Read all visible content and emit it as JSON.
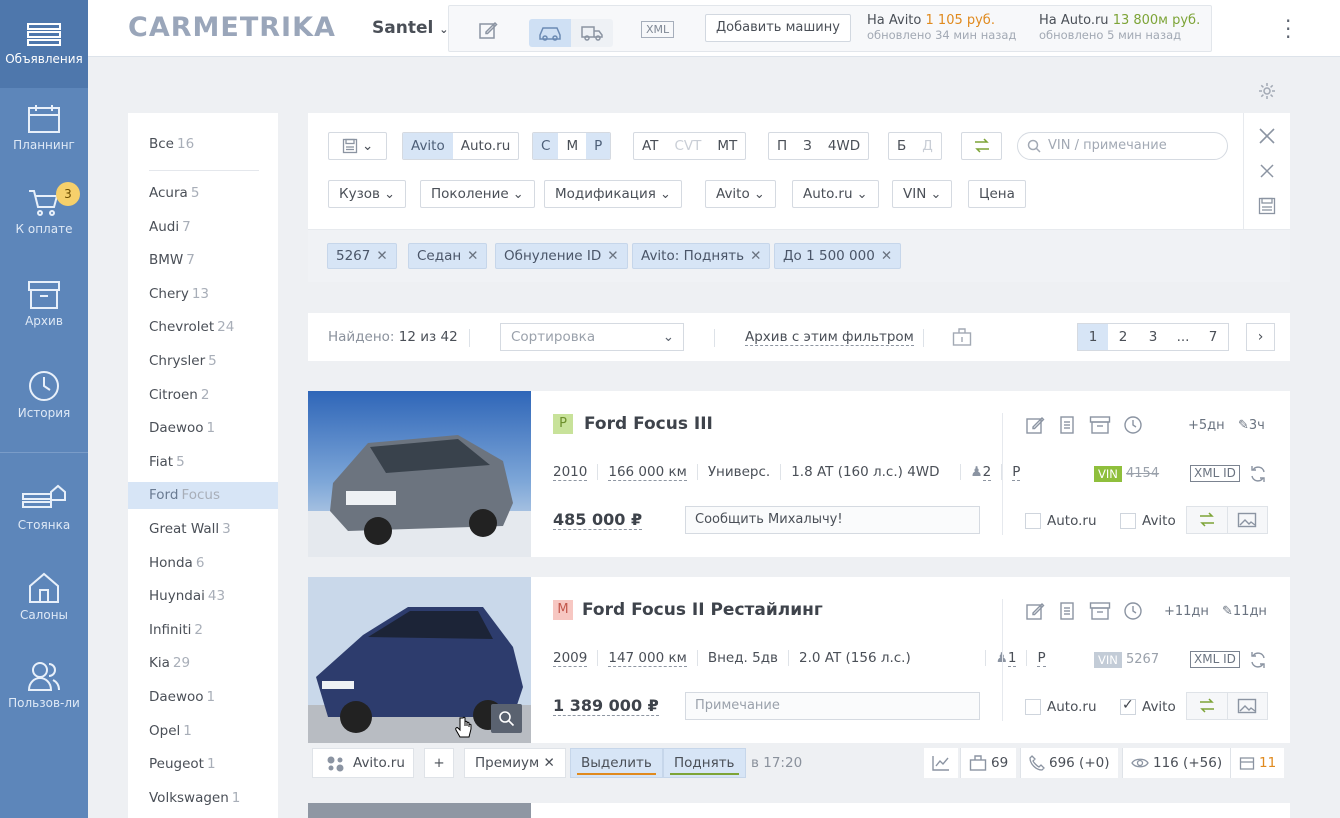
{
  "nav": {
    "items": [
      {
        "label": "Объявления",
        "icon": "listings-icon",
        "active": true
      },
      {
        "label": "Планнинг",
        "icon": "calendar-icon"
      },
      {
        "label": "К оплате",
        "icon": "cart-icon",
        "badge": "3"
      },
      {
        "label": "Архив",
        "icon": "archive-icon"
      },
      {
        "label": "История",
        "icon": "clock-icon"
      },
      {
        "label": "Стоянка",
        "icon": "parking-icon"
      },
      {
        "label": "Салоны",
        "icon": "showroom-icon"
      },
      {
        "label": "Пользов-ли",
        "icon": "users-icon"
      }
    ]
  },
  "header": {
    "logo": "CARMETRIKA",
    "company": "Santel",
    "xml_label": "XML",
    "add_car_label": "Добавить машину",
    "avito_balance": {
      "prefix": "На Avito",
      "amount": "1 105 руб.",
      "updated": "обновлено 34 мин назад"
    },
    "autoru_balance": {
      "prefix": "На Auto.ru",
      "amount": "13 800м руб.",
      "updated": "обновлено 5 мин назад"
    }
  },
  "brands": {
    "all_label": "Все",
    "all_count": "16",
    "items": [
      {
        "name": "Acura",
        "count": "5"
      },
      {
        "name": "Audi",
        "count": "7"
      },
      {
        "name": "BMW",
        "count": "7"
      },
      {
        "name": "Chery",
        "count": "13"
      },
      {
        "name": "Chevrolet",
        "count": "24"
      },
      {
        "name": "Chrysler",
        "count": "5"
      },
      {
        "name": "Citroen",
        "count": "2"
      },
      {
        "name": "Daewoo",
        "count": "1"
      },
      {
        "name": "Fiat",
        "count": "5"
      },
      {
        "name": "Ford",
        "count": "Focus",
        "selected": true
      },
      {
        "name": "Great Wall",
        "count": "3"
      },
      {
        "name": "Honda",
        "count": "6"
      },
      {
        "name": "Huyndai",
        "count": "43"
      },
      {
        "name": "Infiniti",
        "count": "2"
      },
      {
        "name": "Kia",
        "count": "29"
      },
      {
        "name": "Daewoo",
        "count": "1"
      },
      {
        "name": "Opel",
        "count": "1"
      },
      {
        "name": "Peugeot",
        "count": "1"
      },
      {
        "name": "Volkswagen",
        "count": "1"
      }
    ]
  },
  "filters": {
    "sites": [
      "Avito",
      "Auto.ru"
    ],
    "cmp": [
      "С",
      "М",
      "Р"
    ],
    "gearbox": [
      "AT",
      "CVT",
      "MT"
    ],
    "drive": [
      "П",
      "З",
      "4WD"
    ],
    "used": [
      "Б",
      "Д"
    ],
    "search_placeholder": "VIN / примечание",
    "dropdowns": [
      "Кузов",
      "Поколение",
      "Модификация",
      "Avito",
      "Auto.ru",
      "VIN"
    ],
    "price_label": "Цена",
    "tags": [
      "5267",
      "Седан",
      "Обнуление ID",
      "Avito: Поднять",
      "До 1 500 000"
    ]
  },
  "results": {
    "found_label": "Найдено:",
    "found_value": "12 из 42",
    "sort_placeholder": "Сортировка",
    "archive_link": "Архив с этим фильтром",
    "pages": [
      "1",
      "2",
      "3",
      "...",
      "7"
    ],
    "next": "›"
  },
  "cards": [
    {
      "class_letter": "P",
      "class_color": "#c8e29a",
      "class_text_color": "#6d8f2c",
      "title": "Ford Focus III",
      "year": "2010",
      "mileage": "166 000 км",
      "body": "Универс.",
      "engine": "1.8 AT (160 л.с.) 4WD",
      "owners": "2",
      "pts": "Р",
      "price": "485 000 ₽",
      "note": "Сообщить Михалычу!",
      "days_a": "+5дн",
      "days_b": "3ч",
      "vin_label": "VIN",
      "vin_color": "#8fbf3c",
      "vin_number": "4154",
      "xml_id": "XML ID",
      "autoru_label": "Auto.ru",
      "autoru_checked": false,
      "avito_label": "Avito",
      "avito_checked": false
    },
    {
      "class_letter": "M",
      "class_color": "#f7c7c2",
      "class_text_color": "#c2574c",
      "title": "Ford Focus II Рестайлинг",
      "year": "2009",
      "mileage": "147 000 км",
      "body": "Внед. 5дв",
      "engine": "2.0 AT (156 л.с.)",
      "owners": "1",
      "pts": "Р",
      "price": "1 389 000 ₽",
      "note_placeholder": "Примечание",
      "days_a": "+11дн",
      "days_b": "11дн",
      "vin_label": "VIN",
      "vin_color": "#c3ccd7",
      "vin_number": "5267",
      "xml_id": "XML ID",
      "autoru_label": "Auto.ru",
      "autoru_checked": false,
      "avito_label": "Avito",
      "avito_checked": true
    }
  ],
  "card_footer": {
    "site": "Avito.ru",
    "add": "+",
    "premium": "Премиум",
    "highlight": "Выделить",
    "raise": "Поднять",
    "time": "в 17:20",
    "lots": "69",
    "calls": "696 (+0)",
    "views": "116 (+56)",
    "days": "11"
  }
}
